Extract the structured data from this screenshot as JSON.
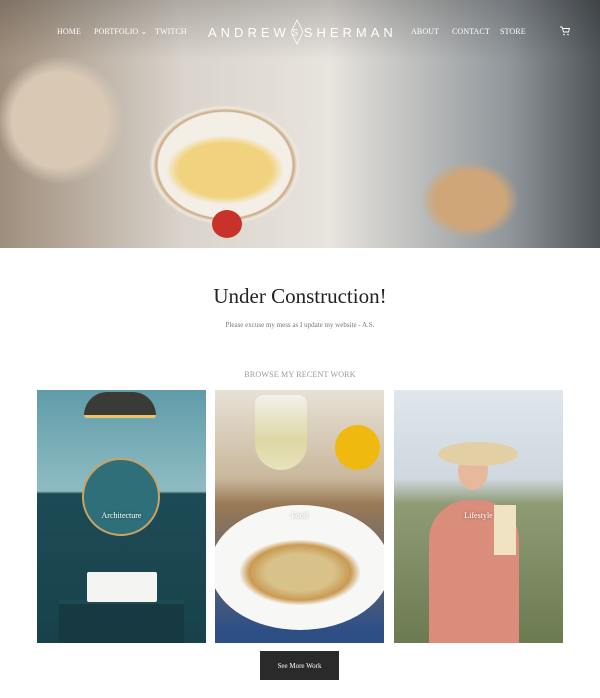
{
  "nav": {
    "left": [
      "HOME",
      "PORTFOLIO",
      "TWITCH"
    ],
    "portfolio_chevron": "chevron-down-icon",
    "logo_left": "ANDREW",
    "logo_mark": "S",
    "logo_right": "SHERMAN",
    "right": [
      "ABOUT",
      "CONTACT",
      "STORE"
    ],
    "cart_icon": "cart-icon"
  },
  "main": {
    "title": "Under Construction!",
    "subtitle": "Please excuse my mess as I update my website - A.S.",
    "browse_label": "BROWSE MY RECENT WORK",
    "cards": [
      {
        "label": "Architecture"
      },
      {
        "label": "Food"
      },
      {
        "label": "Lifestyle"
      }
    ],
    "more_button": "See More Work"
  },
  "colors": {
    "button_bg": "#2a2a2a",
    "heading": "#222222",
    "muted": "#999999"
  }
}
